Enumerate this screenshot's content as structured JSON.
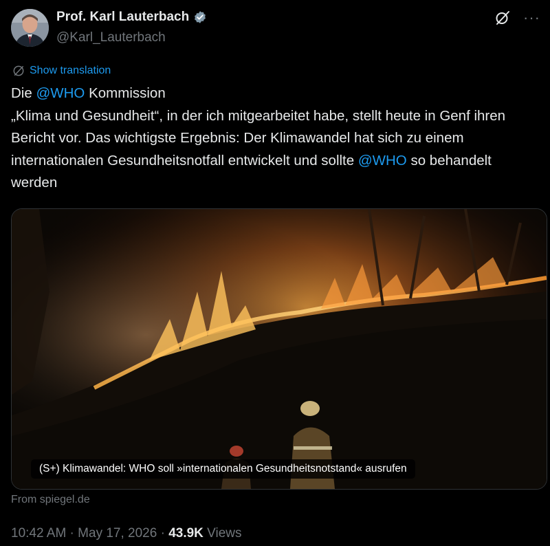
{
  "author": {
    "display_name": "Prof. Karl Lauterbach",
    "handle": "@Karl_Lauterbach",
    "verified_color": "#829aab"
  },
  "header_icons": {
    "grok": "grok-icon",
    "more": "more-icon",
    "more_glyph": "···"
  },
  "translate": {
    "label": "Show translation",
    "icon": "globe-icon"
  },
  "tweet": {
    "line1_prefix": "Die ",
    "mention1": "@WHO",
    "line1_suffix": " Kommission",
    "body": "„Klima und Gesundheit“, in der ich mitgearbeitet habe, stellt heute in Genf ihren Bericht vor. Das wichtigste Ergebnis: Der Klimawandel hat sich zu einem internationalen Gesundheitsnotfall entwickelt und sollte ",
    "mention2": "@WHO",
    "tail": " so behandelt werden"
  },
  "card": {
    "caption": "(S+) Klimawandel: WHO soll »internationalen Gesundheitsnotstand« ausrufen",
    "source": "From spiegel.de"
  },
  "meta": {
    "time": "10:42 AM",
    "separator": " · ",
    "date": "May 17, 2026",
    "separator2": " · ",
    "views_count": "43.9K",
    "views_label": " Views"
  },
  "colors": {
    "background": "#000000",
    "text": "#e7e9ea",
    "secondary": "#71767b",
    "link": "#1d9bf0"
  }
}
